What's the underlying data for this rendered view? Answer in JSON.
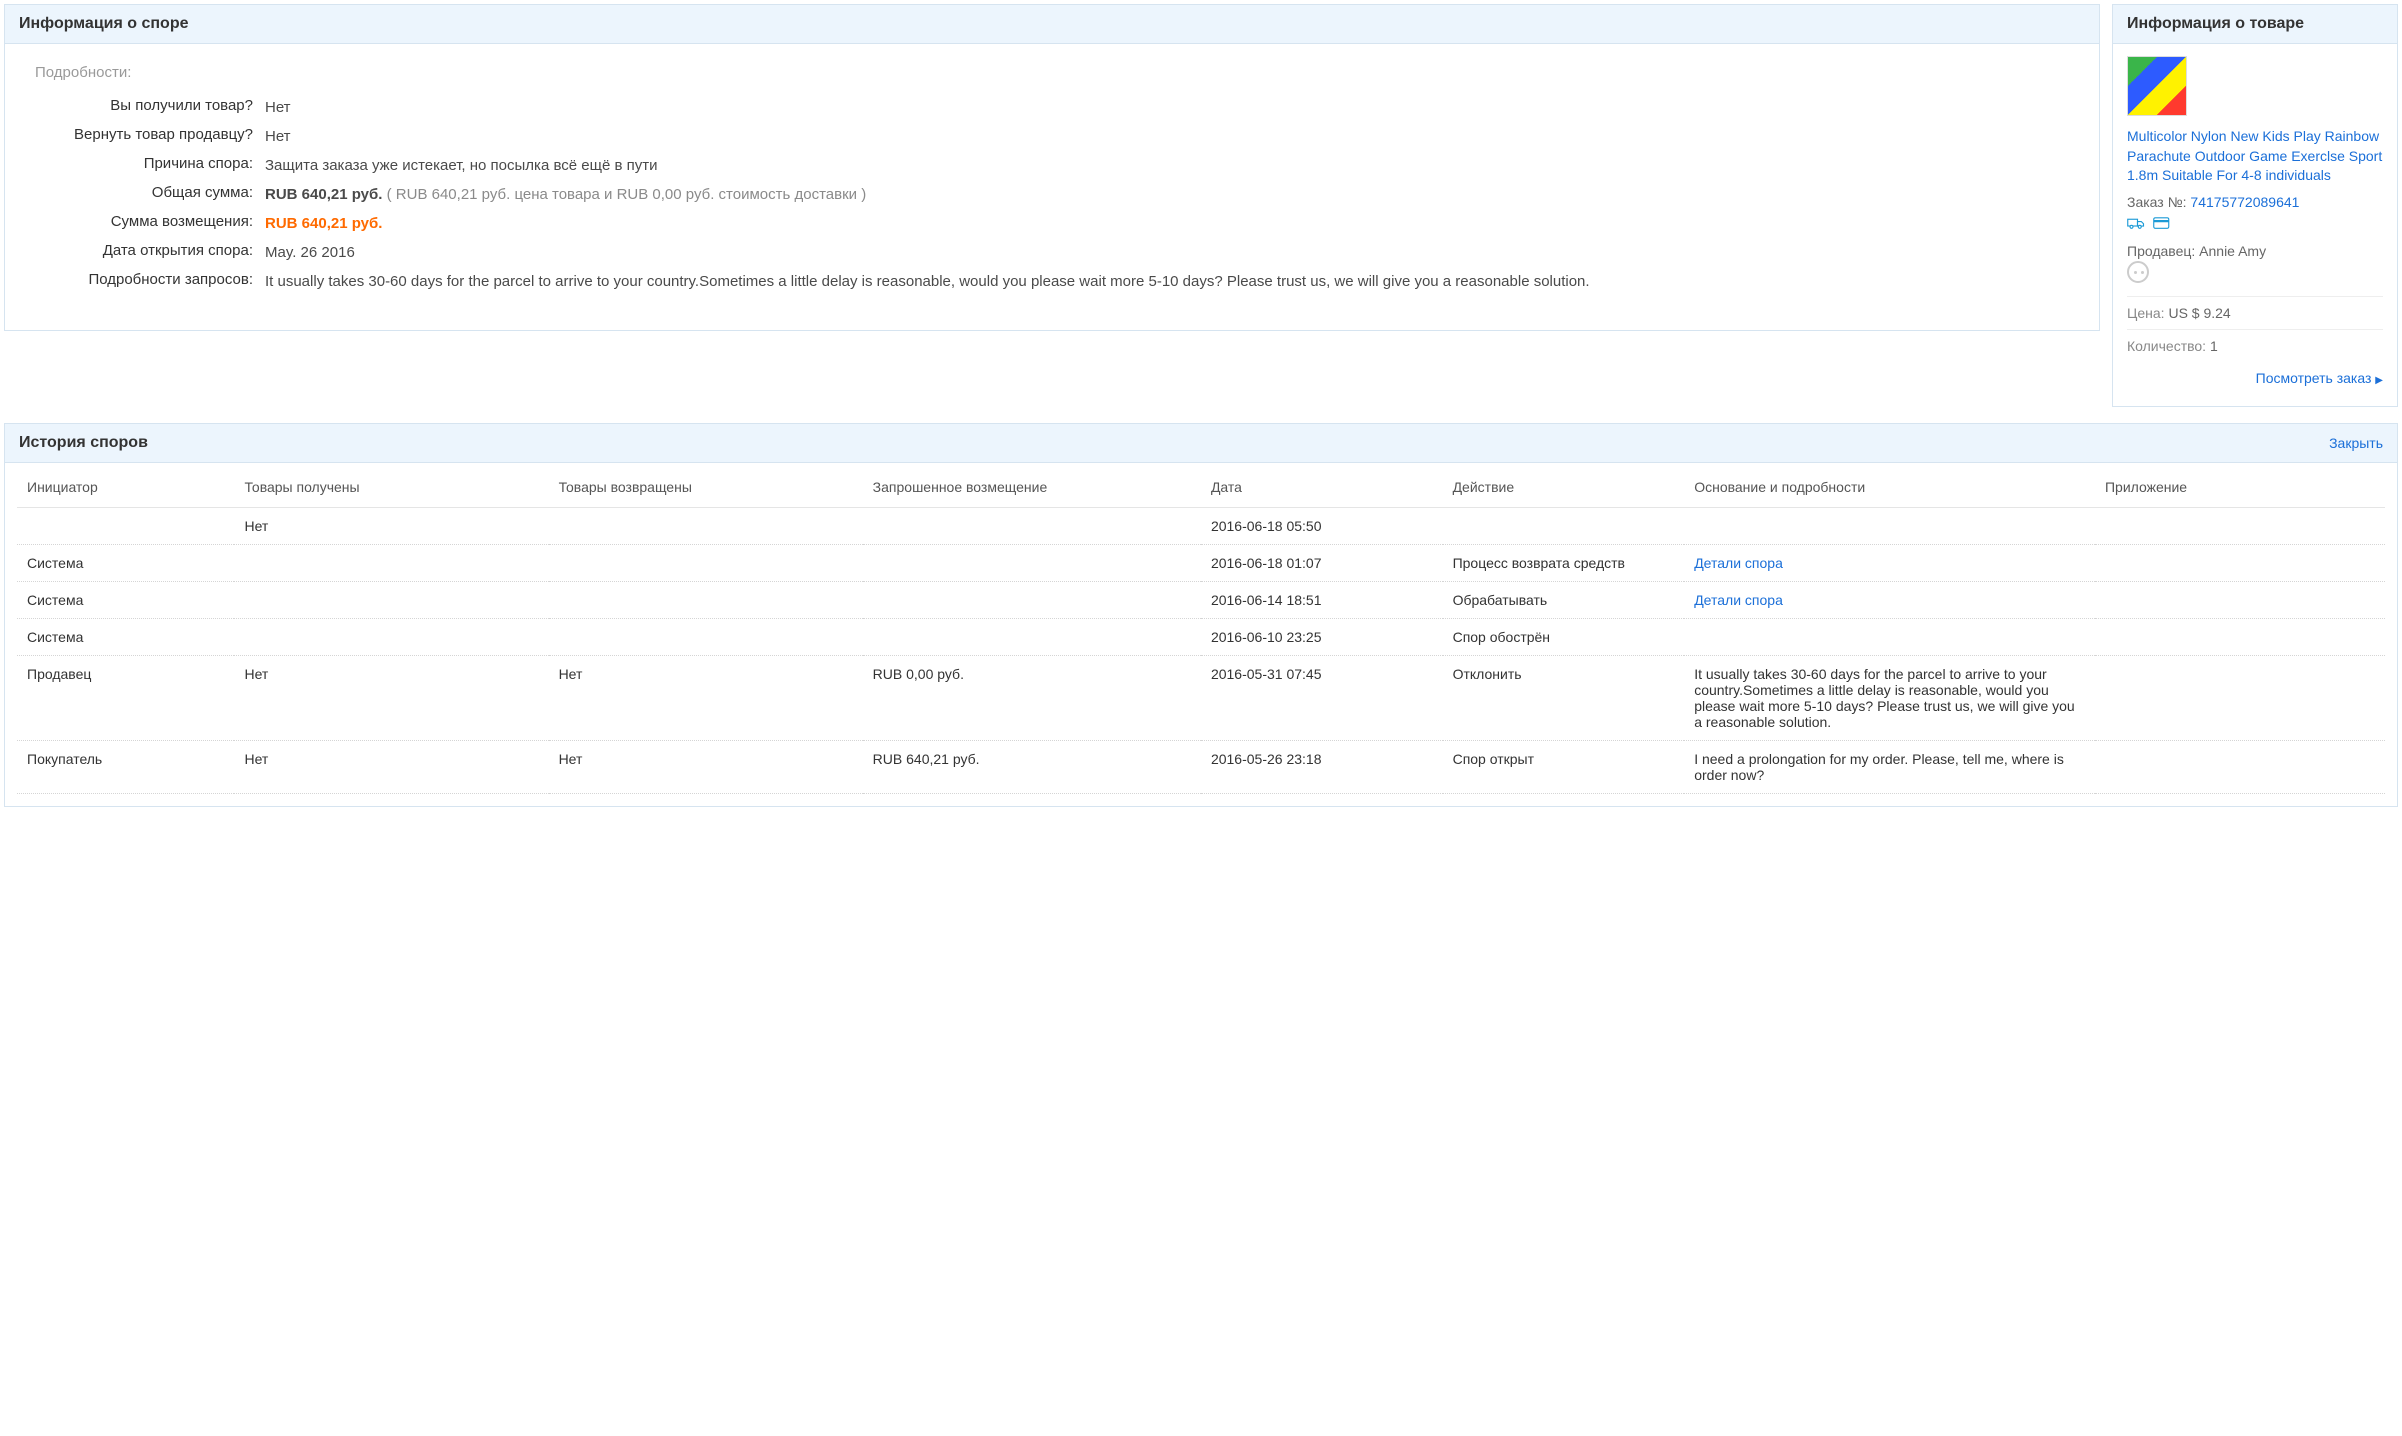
{
  "dispute": {
    "title": "Информация о споре",
    "details_label": "Подробности:",
    "rows": {
      "received_label": "Вы получили товар?",
      "received_value": "Нет",
      "return_label": "Вернуть товар продавцу?",
      "return_value": "Нет",
      "reason_label": "Причина спора:",
      "reason_value": "Защита заказа уже истекает, но посылка всё ещё в пути",
      "total_label": "Общая сумма:",
      "total_bold": "RUB 640,21 руб.",
      "total_grey": "( RUB 640,21 руб. цена товара и RUB 0,00 руб. стоимость доставки )",
      "refund_label": "Сумма возмещения:",
      "refund_value": "RUB 640,21 руб.",
      "opened_label": "Дата открытия спора:",
      "opened_value": "May. 26 2016",
      "request_label": "Подробности запросов:",
      "request_value": "It usually takes 30-60 days for the parcel to arrive to your country.Sometimes a little delay is reasonable, would you please wait more 5-10 days? Please trust us, we will give you a reasonable solution."
    }
  },
  "product": {
    "title": "Информация о товаре",
    "name": "Multicolor Nylon New Kids Play Rainbow Parachute Outdoor Game Exerclse Sport 1.8m Suitable For 4-8 individuals",
    "order_label": "Заказ №:",
    "order_number": "74175772089641",
    "seller_label": "Продавец:",
    "seller_value": "Annie Amy",
    "price_label": "Цена:",
    "price_value": "US $ 9.24",
    "qty_label": "Количество:",
    "qty_value": "1",
    "view_order": "Посмотреть заказ"
  },
  "history": {
    "title": "История споров",
    "close": "Закрыть",
    "headers": {
      "initiator": "Инициатор",
      "goods_received": "Товары получены",
      "goods_returned": "Товары возвращены",
      "requested_refund": "Запрошенное возмещение",
      "date": "Дата",
      "action": "Действие",
      "details": "Основание и подробности",
      "attachment": "Приложение"
    },
    "rows": [
      {
        "initiator": "",
        "goods_received": "Нет",
        "goods_returned": "",
        "requested_refund": "",
        "date": "2016-06-18 05:50",
        "action": "",
        "details": "",
        "details_link": "",
        "attachment": ""
      },
      {
        "initiator": "Система",
        "goods_received": "",
        "goods_returned": "",
        "requested_refund": "",
        "date": "2016-06-18 01:07",
        "action": "Процесс возврата средств",
        "details": "",
        "details_link": "Детали спора",
        "attachment": ""
      },
      {
        "initiator": "Система",
        "goods_received": "",
        "goods_returned": "",
        "requested_refund": "",
        "date": "2016-06-14 18:51",
        "action": "Обрабатывать",
        "details": "",
        "details_link": "Детали спора",
        "attachment": ""
      },
      {
        "initiator": "Система",
        "goods_received": "",
        "goods_returned": "",
        "requested_refund": "",
        "date": "2016-06-10 23:25",
        "action": "Спор обострён",
        "details": "",
        "details_link": "",
        "attachment": ""
      },
      {
        "initiator": "Продавец",
        "goods_received": "Нет",
        "goods_returned": "Нет",
        "requested_refund": "RUB 0,00 руб.",
        "date": "2016-05-31 07:45",
        "action": "Отклонить",
        "details": "It usually takes 30-60 days for the parcel to arrive to your country.Sometimes a little delay is reasonable, would you please wait more 5-10 days? Please trust us, we will give you a reasonable solution.",
        "details_link": "",
        "attachment": ""
      },
      {
        "initiator": "Покупатель",
        "goods_received": "Нет",
        "goods_returned": "Нет",
        "requested_refund": "RUB 640,21 руб.",
        "date": "2016-05-26 23:18",
        "action": "Спор открыт",
        "details": "I need a prolongation for my order. Please, tell me, where is order now?",
        "details_link": "",
        "attachment": ""
      }
    ]
  }
}
